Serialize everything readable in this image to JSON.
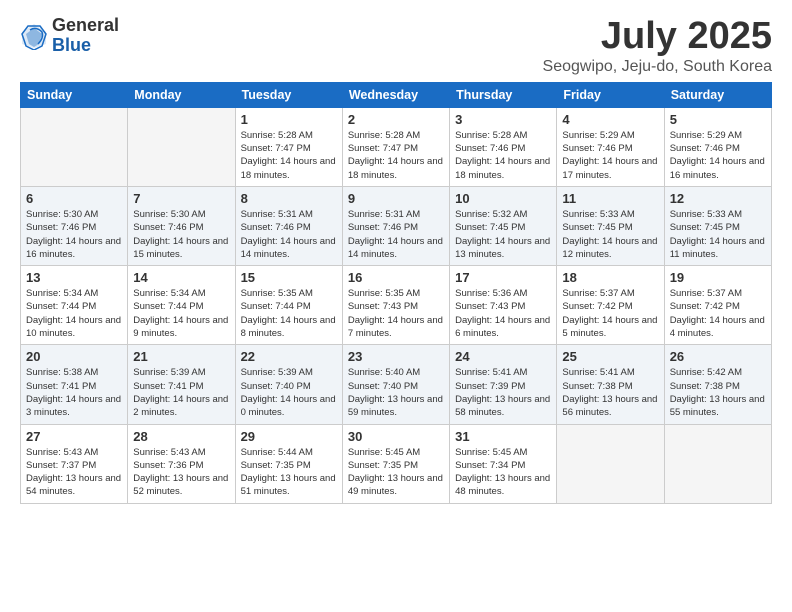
{
  "logo": {
    "general": "General",
    "blue": "Blue"
  },
  "title": "July 2025",
  "subtitle": "Seogwipo, Jeju-do, South Korea",
  "headers": [
    "Sunday",
    "Monday",
    "Tuesday",
    "Wednesday",
    "Thursday",
    "Friday",
    "Saturday"
  ],
  "weeks": [
    [
      {
        "day": "",
        "sunrise": "",
        "sunset": "",
        "daylight": ""
      },
      {
        "day": "",
        "sunrise": "",
        "sunset": "",
        "daylight": ""
      },
      {
        "day": "1",
        "sunrise": "Sunrise: 5:28 AM",
        "sunset": "Sunset: 7:47 PM",
        "daylight": "Daylight: 14 hours and 18 minutes."
      },
      {
        "day": "2",
        "sunrise": "Sunrise: 5:28 AM",
        "sunset": "Sunset: 7:47 PM",
        "daylight": "Daylight: 14 hours and 18 minutes."
      },
      {
        "day": "3",
        "sunrise": "Sunrise: 5:28 AM",
        "sunset": "Sunset: 7:46 PM",
        "daylight": "Daylight: 14 hours and 18 minutes."
      },
      {
        "day": "4",
        "sunrise": "Sunrise: 5:29 AM",
        "sunset": "Sunset: 7:46 PM",
        "daylight": "Daylight: 14 hours and 17 minutes."
      },
      {
        "day": "5",
        "sunrise": "Sunrise: 5:29 AM",
        "sunset": "Sunset: 7:46 PM",
        "daylight": "Daylight: 14 hours and 16 minutes."
      }
    ],
    [
      {
        "day": "6",
        "sunrise": "Sunrise: 5:30 AM",
        "sunset": "Sunset: 7:46 PM",
        "daylight": "Daylight: 14 hours and 16 minutes."
      },
      {
        "day": "7",
        "sunrise": "Sunrise: 5:30 AM",
        "sunset": "Sunset: 7:46 PM",
        "daylight": "Daylight: 14 hours and 15 minutes."
      },
      {
        "day": "8",
        "sunrise": "Sunrise: 5:31 AM",
        "sunset": "Sunset: 7:46 PM",
        "daylight": "Daylight: 14 hours and 14 minutes."
      },
      {
        "day": "9",
        "sunrise": "Sunrise: 5:31 AM",
        "sunset": "Sunset: 7:46 PM",
        "daylight": "Daylight: 14 hours and 14 minutes."
      },
      {
        "day": "10",
        "sunrise": "Sunrise: 5:32 AM",
        "sunset": "Sunset: 7:45 PM",
        "daylight": "Daylight: 14 hours and 13 minutes."
      },
      {
        "day": "11",
        "sunrise": "Sunrise: 5:33 AM",
        "sunset": "Sunset: 7:45 PM",
        "daylight": "Daylight: 14 hours and 12 minutes."
      },
      {
        "day": "12",
        "sunrise": "Sunrise: 5:33 AM",
        "sunset": "Sunset: 7:45 PM",
        "daylight": "Daylight: 14 hours and 11 minutes."
      }
    ],
    [
      {
        "day": "13",
        "sunrise": "Sunrise: 5:34 AM",
        "sunset": "Sunset: 7:44 PM",
        "daylight": "Daylight: 14 hours and 10 minutes."
      },
      {
        "day": "14",
        "sunrise": "Sunrise: 5:34 AM",
        "sunset": "Sunset: 7:44 PM",
        "daylight": "Daylight: 14 hours and 9 minutes."
      },
      {
        "day": "15",
        "sunrise": "Sunrise: 5:35 AM",
        "sunset": "Sunset: 7:44 PM",
        "daylight": "Daylight: 14 hours and 8 minutes."
      },
      {
        "day": "16",
        "sunrise": "Sunrise: 5:35 AM",
        "sunset": "Sunset: 7:43 PM",
        "daylight": "Daylight: 14 hours and 7 minutes."
      },
      {
        "day": "17",
        "sunrise": "Sunrise: 5:36 AM",
        "sunset": "Sunset: 7:43 PM",
        "daylight": "Daylight: 14 hours and 6 minutes."
      },
      {
        "day": "18",
        "sunrise": "Sunrise: 5:37 AM",
        "sunset": "Sunset: 7:42 PM",
        "daylight": "Daylight: 14 hours and 5 minutes."
      },
      {
        "day": "19",
        "sunrise": "Sunrise: 5:37 AM",
        "sunset": "Sunset: 7:42 PM",
        "daylight": "Daylight: 14 hours and 4 minutes."
      }
    ],
    [
      {
        "day": "20",
        "sunrise": "Sunrise: 5:38 AM",
        "sunset": "Sunset: 7:41 PM",
        "daylight": "Daylight: 14 hours and 3 minutes."
      },
      {
        "day": "21",
        "sunrise": "Sunrise: 5:39 AM",
        "sunset": "Sunset: 7:41 PM",
        "daylight": "Daylight: 14 hours and 2 minutes."
      },
      {
        "day": "22",
        "sunrise": "Sunrise: 5:39 AM",
        "sunset": "Sunset: 7:40 PM",
        "daylight": "Daylight: 14 hours and 0 minutes."
      },
      {
        "day": "23",
        "sunrise": "Sunrise: 5:40 AM",
        "sunset": "Sunset: 7:40 PM",
        "daylight": "Daylight: 13 hours and 59 minutes."
      },
      {
        "day": "24",
        "sunrise": "Sunrise: 5:41 AM",
        "sunset": "Sunset: 7:39 PM",
        "daylight": "Daylight: 13 hours and 58 minutes."
      },
      {
        "day": "25",
        "sunrise": "Sunrise: 5:41 AM",
        "sunset": "Sunset: 7:38 PM",
        "daylight": "Daylight: 13 hours and 56 minutes."
      },
      {
        "day": "26",
        "sunrise": "Sunrise: 5:42 AM",
        "sunset": "Sunset: 7:38 PM",
        "daylight": "Daylight: 13 hours and 55 minutes."
      }
    ],
    [
      {
        "day": "27",
        "sunrise": "Sunrise: 5:43 AM",
        "sunset": "Sunset: 7:37 PM",
        "daylight": "Daylight: 13 hours and 54 minutes."
      },
      {
        "day": "28",
        "sunrise": "Sunrise: 5:43 AM",
        "sunset": "Sunset: 7:36 PM",
        "daylight": "Daylight: 13 hours and 52 minutes."
      },
      {
        "day": "29",
        "sunrise": "Sunrise: 5:44 AM",
        "sunset": "Sunset: 7:35 PM",
        "daylight": "Daylight: 13 hours and 51 minutes."
      },
      {
        "day": "30",
        "sunrise": "Sunrise: 5:45 AM",
        "sunset": "Sunset: 7:35 PM",
        "daylight": "Daylight: 13 hours and 49 minutes."
      },
      {
        "day": "31",
        "sunrise": "Sunrise: 5:45 AM",
        "sunset": "Sunset: 7:34 PM",
        "daylight": "Daylight: 13 hours and 48 minutes."
      },
      {
        "day": "",
        "sunrise": "",
        "sunset": "",
        "daylight": ""
      },
      {
        "day": "",
        "sunrise": "",
        "sunset": "",
        "daylight": ""
      }
    ]
  ]
}
